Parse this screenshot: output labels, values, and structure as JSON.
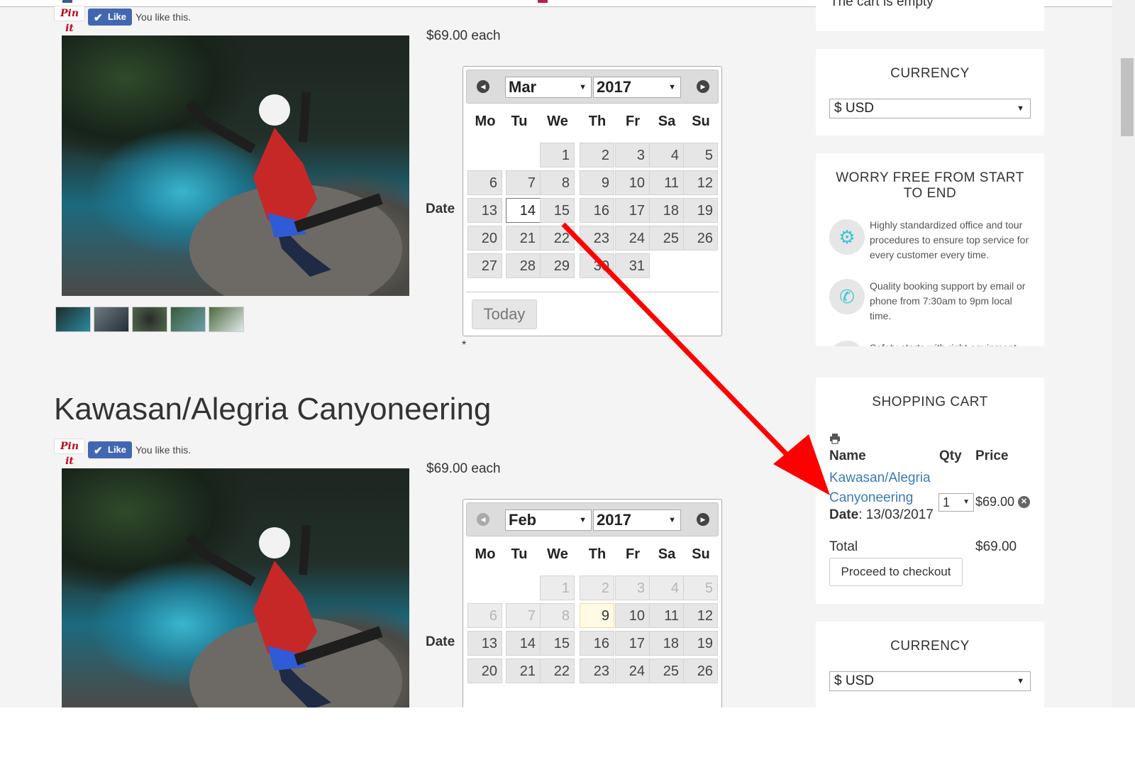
{
  "cart_empty_text": "The cart is empty",
  "social": {
    "pin_label": "Pin it",
    "like_label": "Like",
    "like_status": "You like this."
  },
  "product1": {
    "price": "$69.00 each",
    "date_label": "Date",
    "required_mark": "*",
    "calendar": {
      "month": "Mar",
      "year": "2017",
      "weekdays": [
        "Mo",
        "Tu",
        "We",
        "Th",
        "Fr",
        "Sa",
        "Su"
      ],
      "selected_day": "14",
      "today_label": "Today"
    }
  },
  "product2": {
    "title": "Kawasan/Alegria Canyoneering",
    "price": "$69.00 each",
    "date_label": "Date",
    "calendar": {
      "month": "Feb",
      "year": "2017",
      "weekdays": [
        "Mo",
        "Tu",
        "We",
        "Th",
        "Fr",
        "Sa",
        "Su"
      ],
      "today_day": "9"
    }
  },
  "sidebar": {
    "currency": {
      "title": "CURRENCY",
      "selected": "$ USD"
    },
    "worry": {
      "title": "WORRY FREE FROM START TO END",
      "features": [
        {
          "icon": "gears-icon",
          "text": "Highly standardized office and tour procedures to ensure top service for every customer every time."
        },
        {
          "icon": "phone-icon",
          "text": "Quality booking support by email or phone from 7:30am to 9pm local time."
        },
        {
          "icon": "safety-icon",
          "text": "Safety starts with right equipment"
        }
      ]
    },
    "cart": {
      "title": "SHOPPING CART",
      "col_name": "Name",
      "col_qty": "Qty",
      "col_price": "Price",
      "item_name": "Kawasan/Alegria Canyoneering",
      "item_date_label": "Date",
      "item_date": ": 13/03/2017",
      "item_qty": "1",
      "item_price": "$69.00",
      "total_label": "Total",
      "total_value": "$69.00",
      "checkout_label": "Proceed to checkout"
    },
    "currency2": {
      "title": "CURRENCY",
      "selected": "$ USD"
    }
  },
  "colors": {
    "accent_link": "#3a7ab8",
    "annotation_arrow": "#ff0000",
    "feature_icon": "#38c6d6"
  }
}
